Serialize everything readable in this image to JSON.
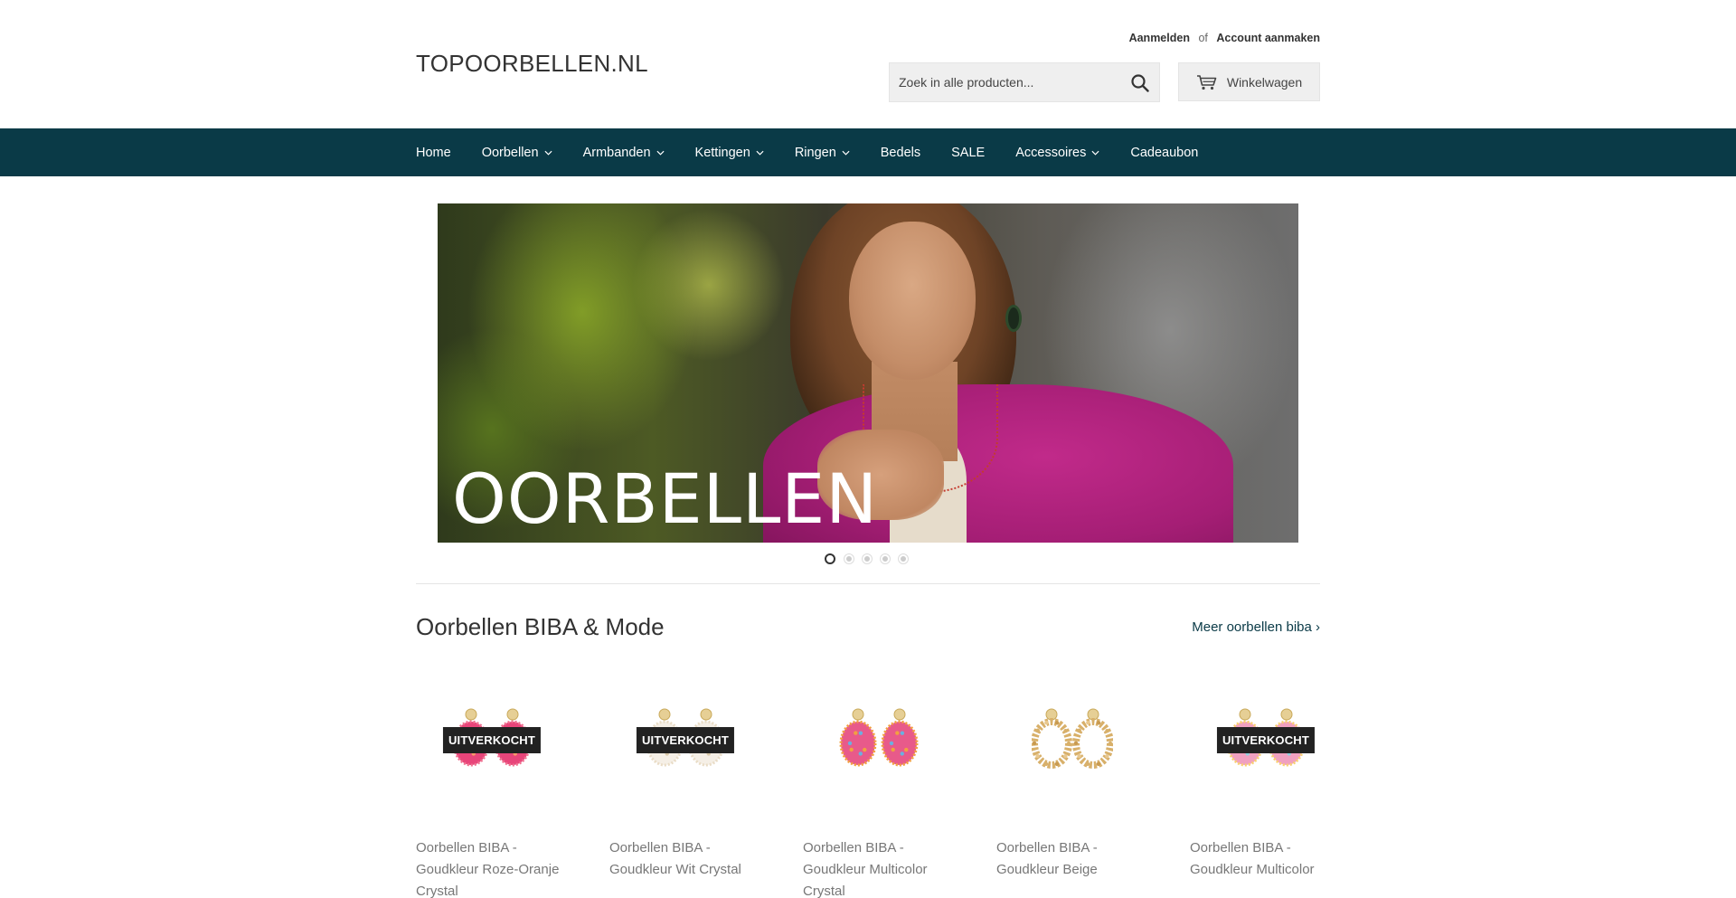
{
  "header": {
    "logo": "TOPOORBELLEN.NL",
    "login": "Aanmelden",
    "or": "of",
    "create_account": "Account aanmaken",
    "search_placeholder": "Zoek in alle producten...",
    "cart_label": "Winkelwagen"
  },
  "nav": {
    "items": [
      {
        "label": "Home",
        "dropdown": false
      },
      {
        "label": "Oorbellen",
        "dropdown": true
      },
      {
        "label": "Armbanden",
        "dropdown": true
      },
      {
        "label": "Kettingen",
        "dropdown": true
      },
      {
        "label": "Ringen",
        "dropdown": true
      },
      {
        "label": "Bedels",
        "dropdown": false
      },
      {
        "label": "SALE",
        "dropdown": false
      },
      {
        "label": "Accessoires",
        "dropdown": true
      },
      {
        "label": "Cadeaubon",
        "dropdown": false
      }
    ]
  },
  "hero": {
    "title": "OORBELLEN",
    "slide_count": 5,
    "active_slide": 1
  },
  "section": {
    "title": "Oorbellen BIBA & Mode",
    "more_link": "Meer oorbellen biba ›"
  },
  "products": [
    {
      "title": "Oorbellen BIBA - Goudkleur Roze-Oranje Crystal",
      "badge": "UITVERKOCHT",
      "price": "",
      "colors": [
        "#e8457a",
        "#f07090",
        "#ff9a6a"
      ]
    },
    {
      "title": "Oorbellen BIBA - Goudkleur Wit Crystal",
      "badge": "UITVERKOCHT",
      "price": "",
      "colors": [
        "#f5efe6",
        "#e9dcc6",
        "#d9c8a8"
      ]
    },
    {
      "title": "Oorbellen BIBA - Goudkleur Multicolor Crystal",
      "badge": "",
      "price": "",
      "colors": [
        "#e85a8a",
        "#f2a040",
        "#6ab0e0"
      ]
    },
    {
      "title": "Oorbellen BIBA - Goudkleur Beige",
      "badge": "",
      "price": "",
      "colors": [
        "#d8b06a",
        "#e8c890",
        "#c89a50"
      ]
    },
    {
      "title": "Oorbellen BIBA - Goudkleur Multicolor",
      "badge": "UITVERKOCHT",
      "price": "",
      "colors": [
        "#f0a0c0",
        "#f8d070",
        "#90d0e0"
      ]
    }
  ],
  "colors": {
    "nav_bg": "#0a3a47",
    "link": "#0a3a47"
  }
}
